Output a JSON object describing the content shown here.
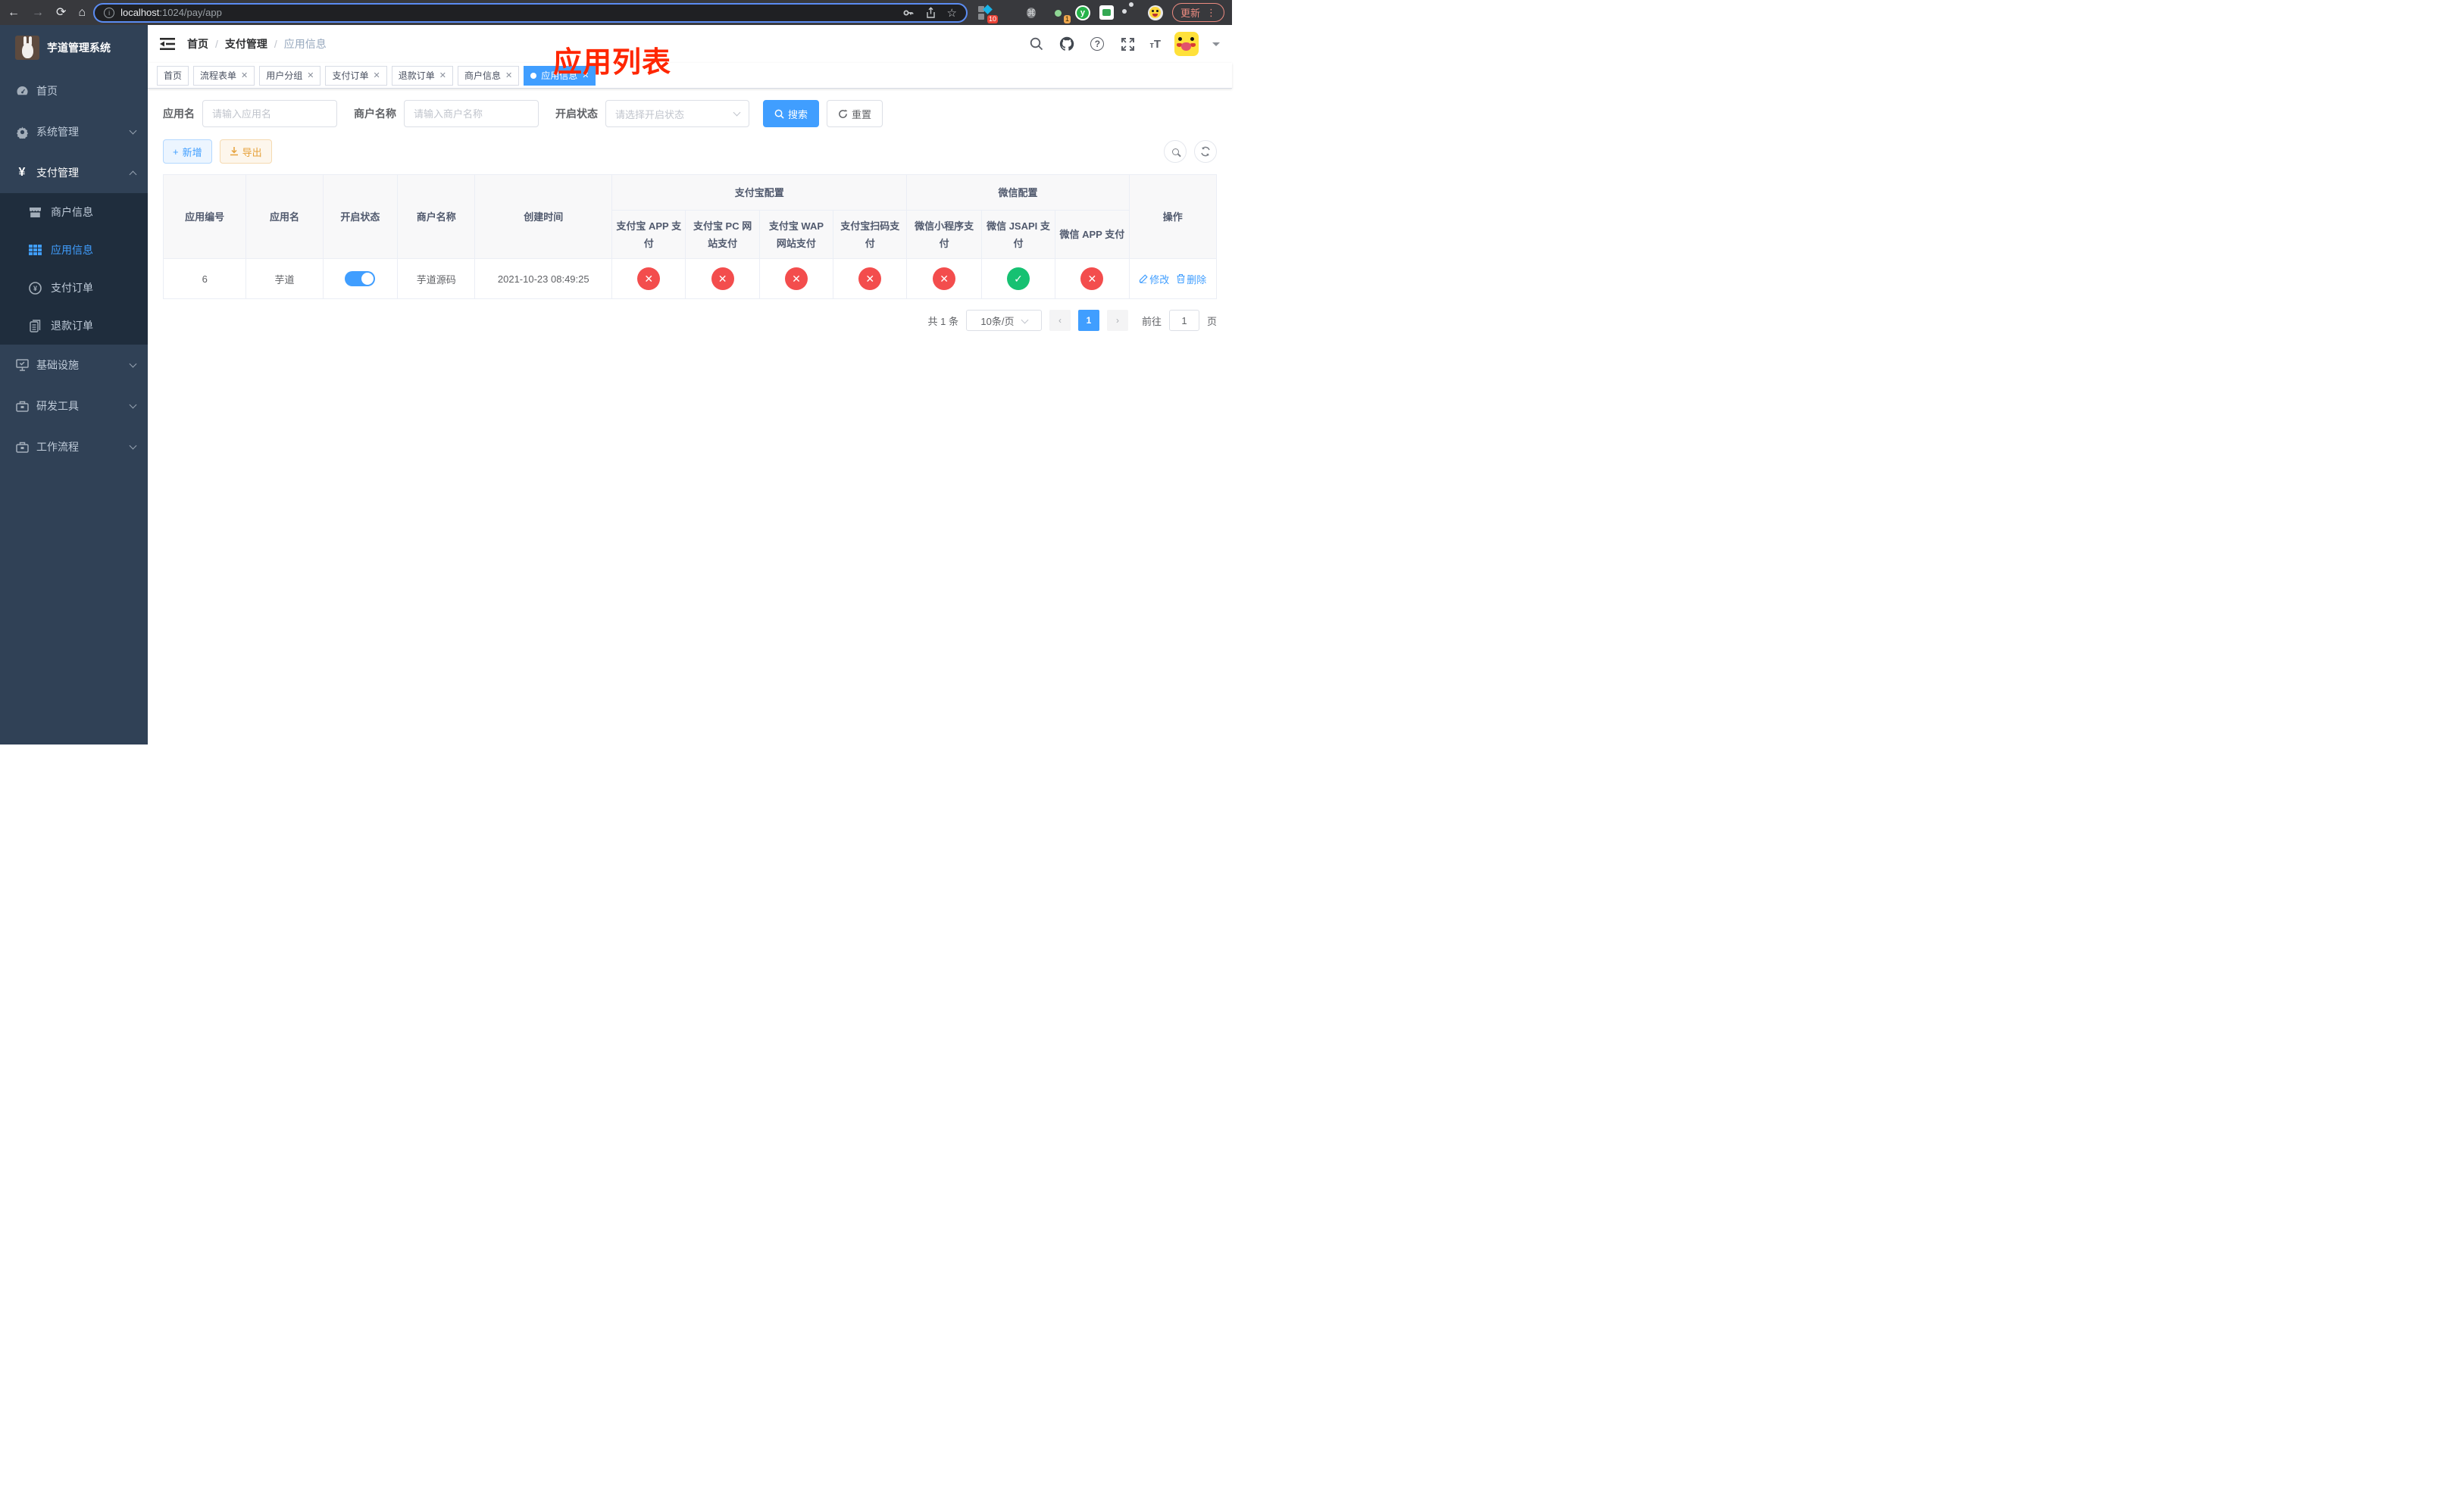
{
  "browser": {
    "url": {
      "host": "localhost",
      "path": ":1024/pay/app"
    },
    "update_label": "更新",
    "menu_dots": "⋮",
    "extensions": {
      "blocks_badge": "10",
      "session_badge": "1",
      "y_letter": "y",
      "command_glyph": "⌘"
    }
  },
  "glyphs": {
    "yes": "✓",
    "no": "✕",
    "close": "✕",
    "plus": "+",
    "info": "i",
    "question": "?",
    "star": "☆"
  },
  "sidebar": {
    "app_title": "芋道管理系统",
    "menu": [
      {
        "label": "首页"
      },
      {
        "label": "系统管理"
      },
      {
        "label": "支付管理"
      },
      {
        "label": "基础设施"
      },
      {
        "label": "研发工具"
      },
      {
        "label": "工作流程"
      }
    ],
    "pay_submenu": [
      {
        "label": "商户信息"
      },
      {
        "label": "应用信息"
      },
      {
        "label": "支付订单"
      },
      {
        "label": "退款订单"
      }
    ]
  },
  "navbar": {
    "breadcrumb": [
      "首页",
      "支付管理",
      "应用信息"
    ],
    "font_size_icon": "tT"
  },
  "overlay_title": "应用列表",
  "tabs": [
    {
      "label": "首页"
    },
    {
      "label": "流程表单"
    },
    {
      "label": "用户分组"
    },
    {
      "label": "支付订单"
    },
    {
      "label": "退款订单"
    },
    {
      "label": "商户信息"
    },
    {
      "label": "应用信息"
    }
  ],
  "filters": {
    "app_name_label": "应用名",
    "app_name_placeholder": "请输入应用名",
    "merchant_label": "商户名称",
    "merchant_placeholder": "请输入商户名称",
    "status_label": "开启状态",
    "status_placeholder": "请选择开启状态",
    "search_label": "搜索",
    "reset_label": "重置"
  },
  "toolbar": {
    "add_label": "新增",
    "export_label": "导出"
  },
  "table": {
    "columns": {
      "app_id": "应用编号",
      "app_name": "应用名",
      "status": "开启状态",
      "merchant": "商户名称",
      "create_time": "创建时间",
      "actions": "操作"
    },
    "groups": {
      "alipay": "支付宝配置",
      "wechat": "微信配置"
    },
    "sub_columns": [
      "支付宝 APP 支付",
      "支付宝 PC 网站支付",
      "支付宝 WAP 网站支付",
      "支付宝扫码支付",
      "微信小程序支付",
      "微信 JSAPI 支付",
      "微信 APP 支付"
    ],
    "row": {
      "app_id": "6",
      "app_name": "芋道",
      "enabled": true,
      "merchant": "芋道源码",
      "create_time": "2021-10-23 08:49:25",
      "pay_channels": [
        false,
        false,
        false,
        false,
        false,
        true,
        false
      ],
      "edit_label": "修改",
      "delete_label": "删除"
    }
  },
  "pagination": {
    "total_text": "共 1 条",
    "page_size": "10条/页",
    "current_page": "1",
    "jump_prefix": "前往",
    "jump_value": "1",
    "jump_suffix": "页"
  }
}
